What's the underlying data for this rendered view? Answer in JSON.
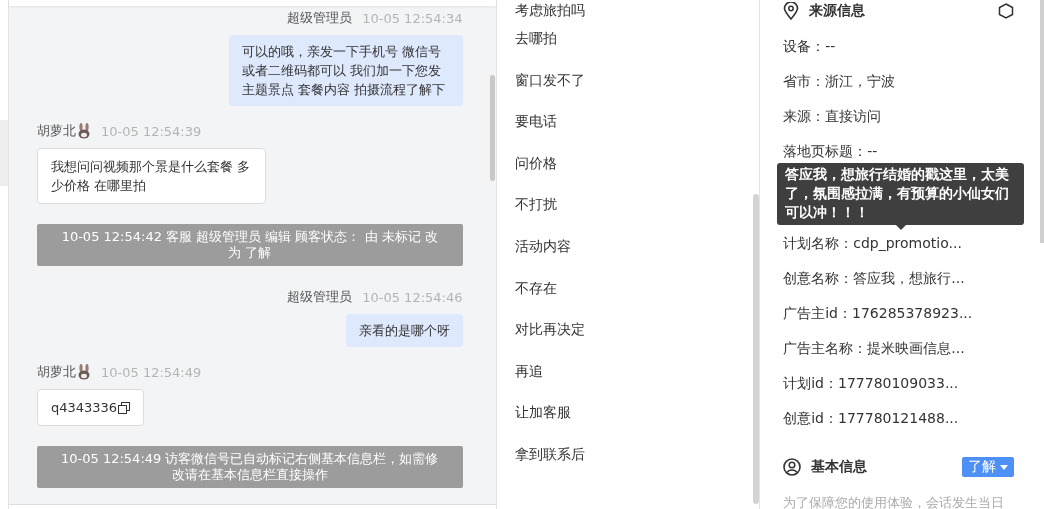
{
  "chat": {
    "messages": [
      {
        "kind": "agent",
        "sender": "超级管理员",
        "time": "10-05 12:54:34",
        "text": "可以的哦，亲发一下手机号 微信号或者二维码都可以 我们加一下您发主题景点 套餐内容 拍摄流程了解下"
      },
      {
        "kind": "visitor",
        "sender": "胡萝北",
        "time": "10-05 12:54:39",
        "text": "我想问问视频那个景是什么套餐 多少价格 在哪里拍"
      },
      {
        "kind": "system",
        "text": "10-05 12:54:42 客服 超级管理员 编辑 顾客状态： 由 未标记 改为 了解"
      },
      {
        "kind": "agent",
        "sender": "超级管理员",
        "time": "10-05 12:54:46",
        "text": "亲看的是哪个呀"
      },
      {
        "kind": "visitor",
        "sender": "胡萝北",
        "time": "10-05 12:54:49",
        "text": "q4343336",
        "copyable": true
      },
      {
        "kind": "system",
        "text": "10-05 12:54:49 访客微信号已自动标记右侧基本信息栏，如需修改请在基本信息栏直接操作"
      }
    ]
  },
  "quick_replies": [
    "考虑旅拍吗",
    "去哪拍",
    "窗口发不了",
    "要电话",
    "问价格",
    "不打扰",
    "活动内容",
    "不存在",
    "对比再决定",
    "再追",
    "让加客服",
    "拿到联系后"
  ],
  "source_info": {
    "title": "来源信息",
    "fields": [
      "设备：--",
      "省市：浙江，宁波",
      "来源：直接访问",
      "落地页标题：--",
      "计划名称：cdp_promotio...",
      "创意名称：答应我，想旅行...",
      "广告主id：176285378923...",
      "广告主名称：提米映画信息...",
      "计划id：177780109033...",
      "创意id：177780121488..."
    ],
    "tooltip": "答应我，想旅行结婚的戳这里，太美了，氛围感拉满，有预算的小仙女们可以冲！！！"
  },
  "basic_info": {
    "title": "基本信息",
    "status": "了解",
    "note": "为了保障您的使用体验，会话发生当日"
  }
}
